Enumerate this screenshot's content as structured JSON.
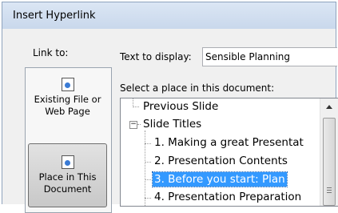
{
  "window": {
    "title": "Insert Hyperlink"
  },
  "link_to": {
    "label": "Link to:",
    "buttons": [
      {
        "label": "Existing File or Web Page",
        "icon": "existing-file-icon"
      },
      {
        "label": "Place in This Document",
        "icon": "document-place-icon",
        "selected": true
      }
    ]
  },
  "text_to_display": {
    "label": "Text to display:",
    "value": "Sensible Planning"
  },
  "select_place": {
    "label": "Select a place in this document:"
  },
  "tree": {
    "items": [
      {
        "label": "Previous Slide",
        "level": 0
      },
      {
        "label": "Slide Titles",
        "level": 0,
        "expanded": true
      },
      {
        "label": "1. Making a great Presentat",
        "level": 1
      },
      {
        "label": "2. Presentation Contents",
        "level": 1
      },
      {
        "label": "3. Before you start: Plan",
        "level": 1,
        "selected": true
      },
      {
        "label": "4. Presentation Preparation",
        "level": 1
      }
    ]
  },
  "colors": {
    "selection": "#3399ff",
    "titlebar": "#c9d8ec",
    "dialog_bg": "#f0f0f0"
  }
}
